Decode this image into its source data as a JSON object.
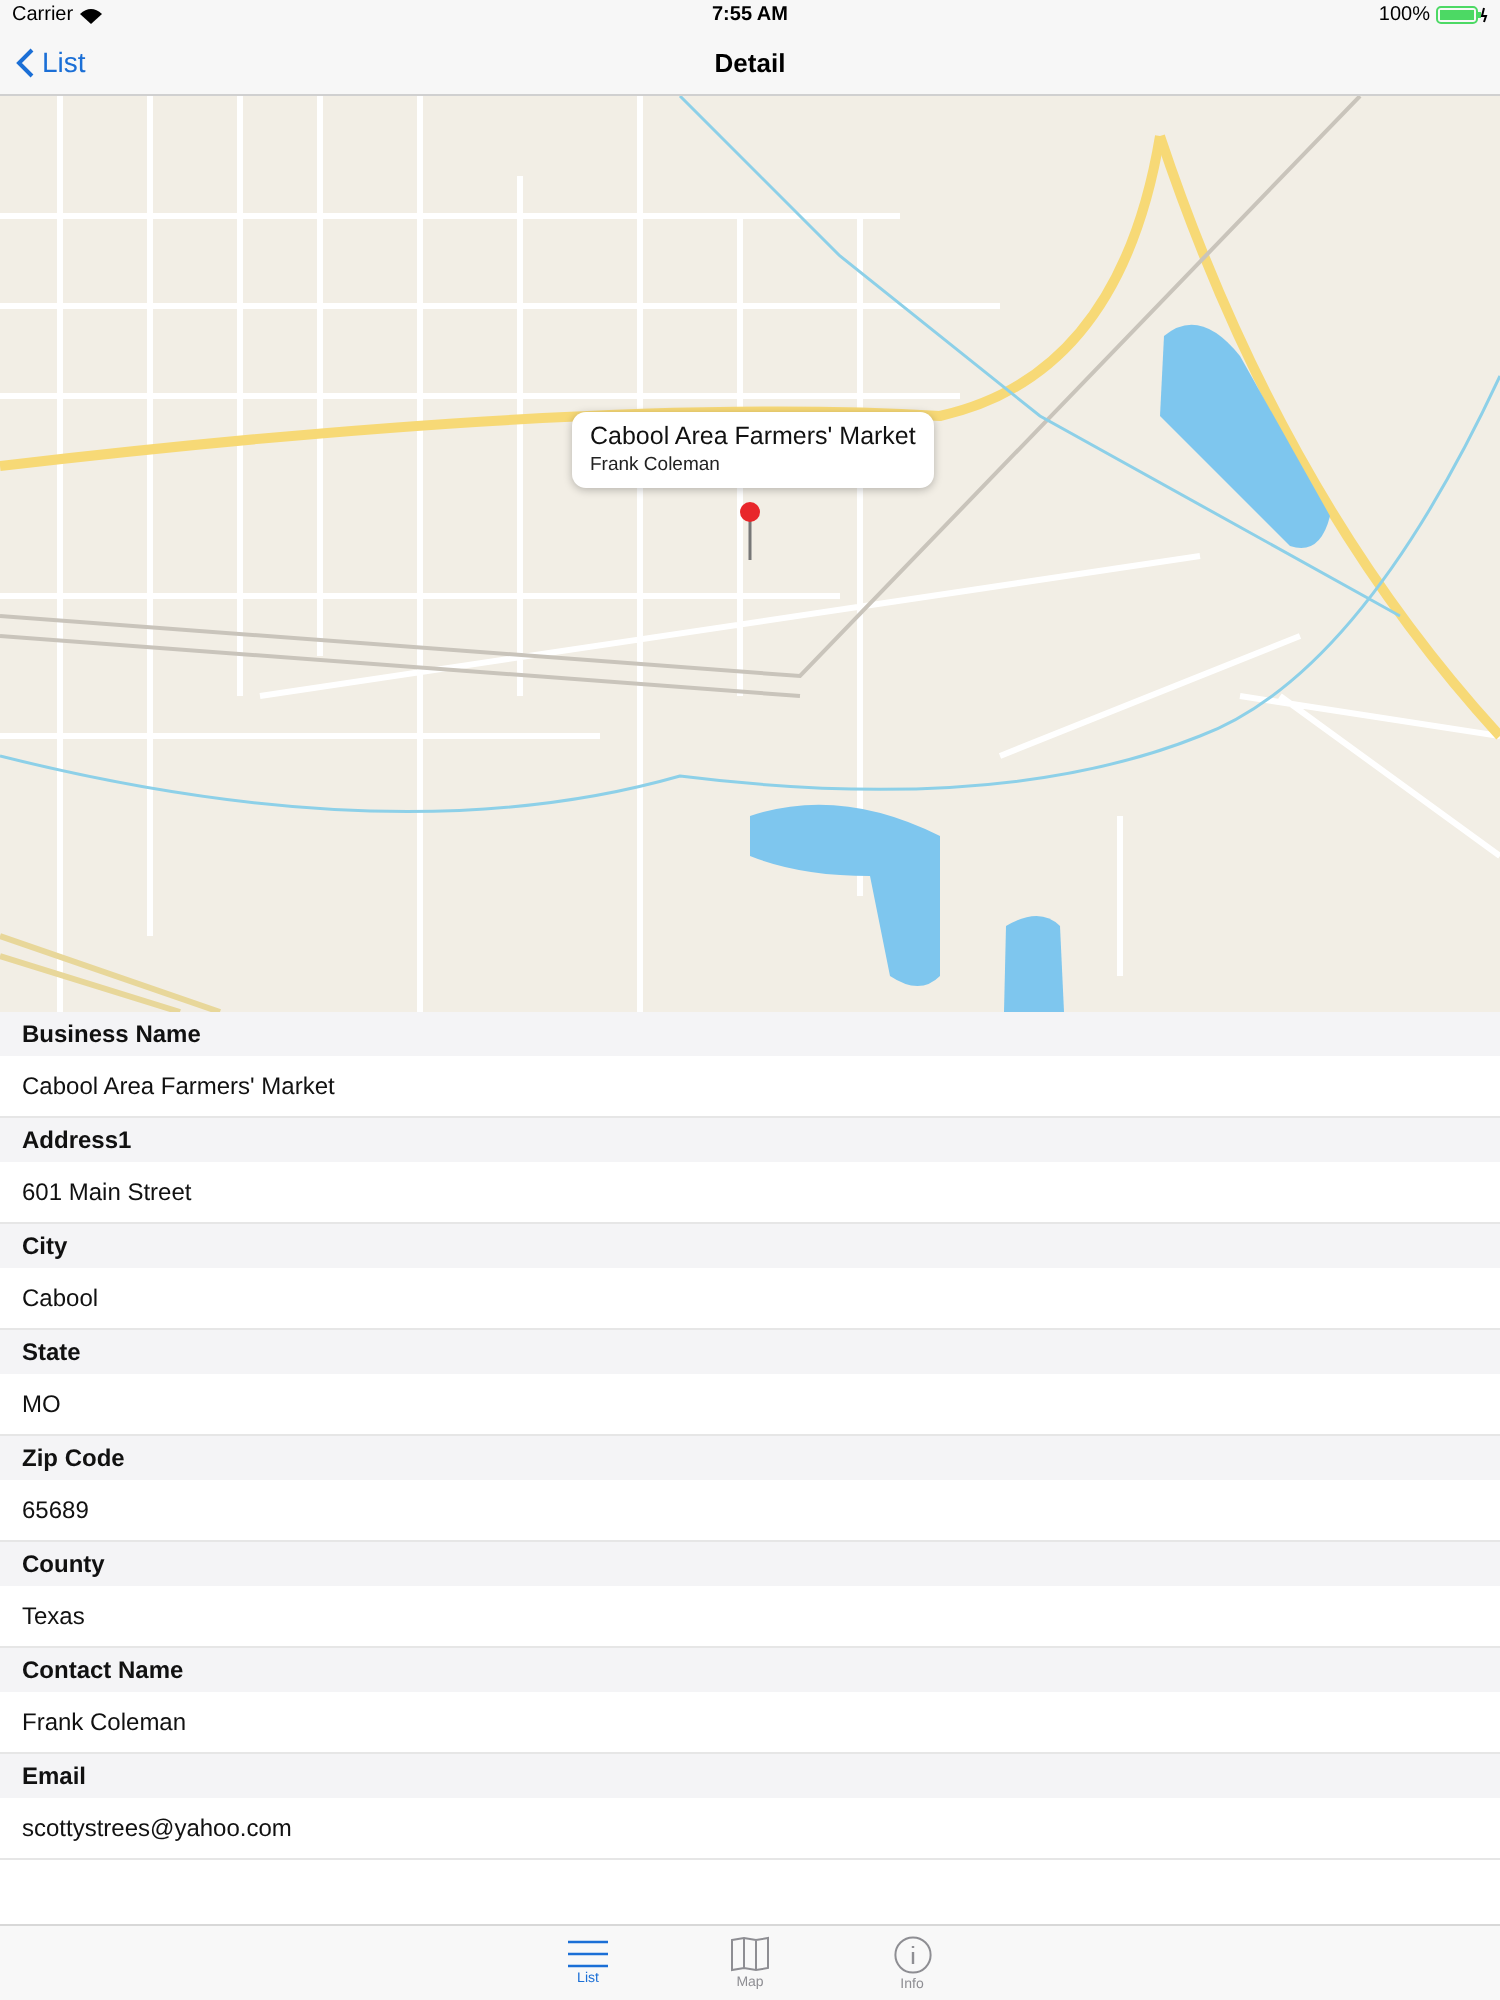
{
  "status_bar": {
    "carrier": "Carrier",
    "time": "7:55 AM",
    "battery": "100%"
  },
  "nav": {
    "back": "List",
    "title": "Detail"
  },
  "map": {
    "callout": {
      "title": "Cabool Area Farmers' Market",
      "subtitle": "Frank Coleman"
    }
  },
  "fields": [
    {
      "label": "Business Name",
      "value": "Cabool Area Farmers' Market"
    },
    {
      "label": "Address1",
      "value": "601 Main Street"
    },
    {
      "label": "City",
      "value": "Cabool"
    },
    {
      "label": "State",
      "value": "MO"
    },
    {
      "label": "Zip Code",
      "value": "65689"
    },
    {
      "label": "County",
      "value": "Texas"
    },
    {
      "label": "Contact Name",
      "value": "Frank Coleman"
    },
    {
      "label": "Email",
      "value": "scottystrees@yahoo.com"
    }
  ],
  "tabs": [
    {
      "kind": "list",
      "label": "List",
      "selected": true
    },
    {
      "kind": "map",
      "label": "Map",
      "selected": false
    },
    {
      "kind": "info",
      "label": "Info",
      "selected": false
    }
  ]
}
